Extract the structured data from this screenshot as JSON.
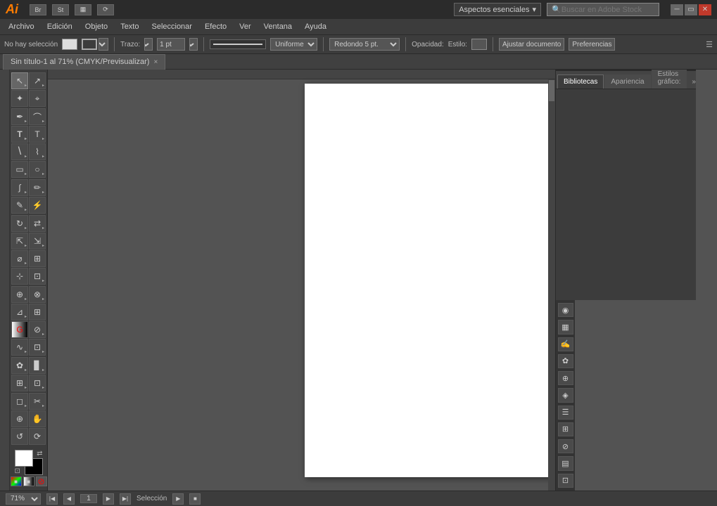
{
  "app": {
    "name": "Ai",
    "title": "Sin título-1 al 71% (CMYK/Previsualizar)"
  },
  "titlebar": {
    "workspace_label": "Aspectos esenciales",
    "search_placeholder": "Buscar en Adobe Stock",
    "icons": [
      "Br",
      "St",
      "▦",
      "⟳"
    ]
  },
  "menubar": {
    "items": [
      "Archivo",
      "Edición",
      "Objeto",
      "Texto",
      "Seleccionar",
      "Efecto",
      "Ver",
      "Ventana",
      "Ayuda"
    ]
  },
  "optionsbar": {
    "selection_label": "No hay selección",
    "trazo_label": "Trazo:",
    "stroke_value": "1 pt",
    "stroke_style": "Uniforme",
    "cap_style": "Redondo 5 pt.",
    "opacity_label": "Opacidad:",
    "style_label": "Estilo:",
    "adjust_doc_btn": "Ajustar documento",
    "preferences_btn": "Preferencias"
  },
  "tab": {
    "title": "Sin título-1 al 71% (CMYK/Previsualizar)",
    "close": "×"
  },
  "toolbox": {
    "tools": [
      {
        "row": [
          {
            "name": "select",
            "icon": "↖",
            "active": true
          },
          {
            "name": "direct-select",
            "icon": "↗"
          }
        ]
      },
      {
        "row": [
          {
            "name": "magic-wand",
            "icon": "✦"
          },
          {
            "name": "lasso",
            "icon": "⌖"
          }
        ]
      },
      {
        "row": [
          {
            "name": "pen",
            "icon": "✒"
          },
          {
            "name": "curvature",
            "icon": "⌒"
          }
        ]
      },
      {
        "row": [
          {
            "name": "text",
            "icon": "T"
          },
          {
            "name": "touch-type",
            "icon": "Ŧ"
          }
        ]
      },
      {
        "row": [
          {
            "name": "line",
            "icon": "/"
          },
          {
            "name": "arc",
            "icon": "⌇"
          }
        ]
      },
      {
        "row": [
          {
            "name": "rect",
            "icon": "▭"
          },
          {
            "name": "ellipse",
            "icon": "○"
          }
        ]
      },
      {
        "row": [
          {
            "name": "paintbrush",
            "icon": "🖌"
          },
          {
            "name": "blob",
            "icon": "✏"
          }
        ]
      },
      {
        "row": [
          {
            "name": "pencil",
            "icon": "✎"
          },
          {
            "name": "shaper",
            "icon": "⚡"
          }
        ]
      },
      {
        "row": [
          {
            "name": "rotate",
            "icon": "↻"
          },
          {
            "name": "reflect",
            "icon": "⇄"
          }
        ]
      },
      {
        "row": [
          {
            "name": "scale",
            "icon": "⇱"
          },
          {
            "name": "reshape",
            "icon": "⇲"
          }
        ]
      },
      {
        "row": [
          {
            "name": "warp",
            "icon": "⌀"
          },
          {
            "name": "free-transform",
            "icon": "⊞"
          }
        ]
      },
      {
        "row": [
          {
            "name": "puppet-warp",
            "icon": "⊹"
          },
          {
            "name": "perspective",
            "icon": "⊡"
          }
        ]
      },
      {
        "row": [
          {
            "name": "shape-builder",
            "icon": "⊕"
          },
          {
            "name": "live-paint",
            "icon": "⊗"
          }
        ]
      },
      {
        "row": [
          {
            "name": "perspective-grid",
            "icon": "⊿"
          },
          {
            "name": "mesh",
            "icon": "⊞"
          }
        ]
      },
      {
        "row": [
          {
            "name": "gradient",
            "icon": "⊗"
          },
          {
            "name": "eyedropper",
            "icon": "⊘"
          }
        ]
      },
      {
        "row": [
          {
            "name": "blend",
            "icon": "∿"
          },
          {
            "name": "live-paint-select",
            "icon": "⊡"
          }
        ]
      },
      {
        "row": [
          {
            "name": "symbol-sprayer",
            "icon": "✿"
          },
          {
            "name": "column-graph",
            "icon": "▊"
          }
        ]
      },
      {
        "row": [
          {
            "name": "artboard",
            "icon": "⊞"
          },
          {
            "name": "slice",
            "icon": "⊡"
          }
        ]
      },
      {
        "row": [
          {
            "name": "eraser",
            "icon": "◻"
          },
          {
            "name": "scissors",
            "icon": "✂"
          }
        ]
      },
      {
        "row": [
          {
            "name": "zoom",
            "icon": "⊕"
          },
          {
            "name": "hand",
            "icon": "✋"
          }
        ]
      },
      {
        "row": [
          {
            "name": "rotate-view",
            "icon": "↺"
          },
          {
            "name": "rotate-tool",
            "icon": "⟳"
          }
        ]
      }
    ],
    "fg_color": "#ffffff",
    "bg_color": "#000000",
    "color_modes": [
      "color",
      "gradient",
      "none"
    ],
    "screen_mode": "▭"
  },
  "panels": {
    "group1": {
      "tabs": [
        {
          "label": "Bibliotecas",
          "active": true
        },
        {
          "label": "Apariencia",
          "active": false
        },
        {
          "label": "Estilos gráfico:",
          "active": false
        }
      ]
    }
  },
  "statusbar": {
    "zoom_value": "71%",
    "selection_label": "Selección"
  },
  "rightbar": {
    "icons": [
      "◉",
      "▦",
      "⊞",
      "☰",
      "◉",
      "⊕",
      "⊞",
      "☰"
    ]
  }
}
